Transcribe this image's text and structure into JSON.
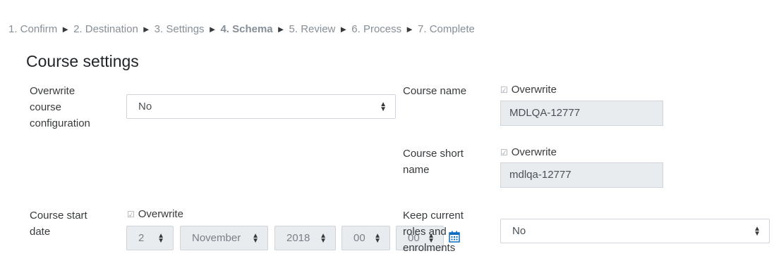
{
  "breadcrumb": {
    "steps": [
      "1. Confirm",
      "2. Destination",
      "3. Settings",
      "4. Schema",
      "5. Review",
      "6. Process",
      "7. Complete"
    ],
    "separator": "►"
  },
  "section_title": "Course settings",
  "overwrite_config": {
    "label_lines": [
      "Overwrite",
      "course",
      "configuration"
    ],
    "value": "No"
  },
  "course_name": {
    "label": "Course name",
    "overwrite_label": "Overwrite",
    "value": "MDLQA-12777"
  },
  "course_short_name": {
    "label_lines": [
      "Course short",
      "name"
    ],
    "overwrite_label": "Overwrite",
    "value": "mdlqa-12777"
  },
  "course_start_date": {
    "label_lines": [
      "Course start",
      "date"
    ],
    "overwrite_label": "Overwrite",
    "day": "2",
    "month": "November",
    "year": "2018",
    "hour": "00",
    "minute": "00"
  },
  "keep_roles": {
    "label_lines": [
      "Keep current",
      "roles and",
      "enrolments"
    ],
    "value": "No"
  },
  "icons": {
    "checkbox": "checked-checkbox-icon",
    "calendar": "calendar-icon",
    "select_arrows": "up-down-arrows-icon"
  },
  "colors": {
    "link_blue": "#0f6cbf",
    "disabled_bg": "#e9ecef",
    "border": "#ced4da"
  }
}
